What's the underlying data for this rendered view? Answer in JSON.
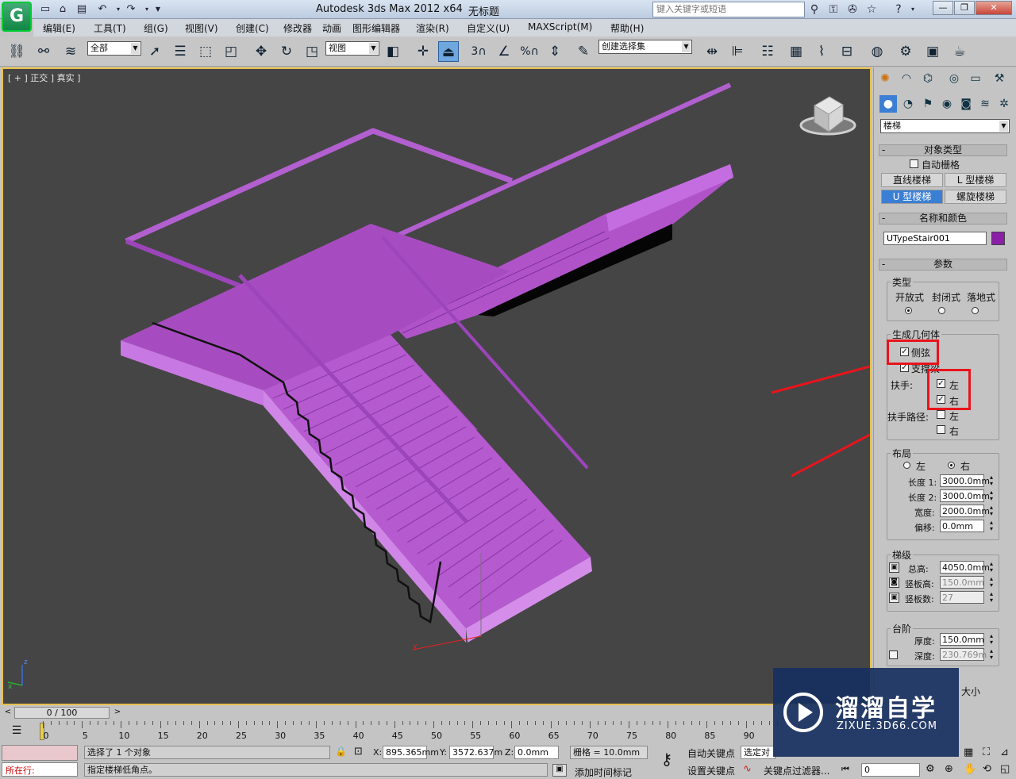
{
  "app": {
    "title": "Autodesk 3ds Max  2012 x64",
    "doc": "无标题",
    "logo": "G",
    "search_placeholder": "键入关键字或短语"
  },
  "menu": [
    "编辑(E)",
    "工具(T)",
    "组(G)",
    "视图(V)",
    "创建(C)",
    "修改器",
    "动画",
    "图形编辑器",
    "渲染(R)",
    "自定义(U)",
    "MAXScript(M)",
    "帮助(H)"
  ],
  "toolbar": {
    "filter": "全部",
    "ref_coord": "视图",
    "selection_set": "创建选择集",
    "snap_3": "3",
    "snap_pct": "%"
  },
  "viewport": {
    "label": "[ + ] 正交 ] 真实 ]",
    "axis_x": "x",
    "axis_y": "y",
    "axis_z": "z",
    "object_color": "#a84fc4"
  },
  "panel": {
    "category": "楼梯",
    "object_type": {
      "title": "对象类型",
      "auto_grid": "自动栅格",
      "buttons": [
        "直线楼梯",
        "L 型楼梯",
        "U 型楼梯",
        "螺旋楼梯"
      ],
      "active": "U 型楼梯"
    },
    "name_color": {
      "title": "名称和颜色",
      "name": "UTypeStair001",
      "color": "#8a1fa8"
    },
    "params": {
      "title": "参数",
      "type": {
        "title": "类型",
        "options": [
          "开放式",
          "封闭式",
          "落地式"
        ]
      },
      "geometry": {
        "title": "生成几何体",
        "stringers": "侧弦",
        "carriage": "支撑梁",
        "handrail": "扶手:",
        "left": "左",
        "right": "右",
        "rail_path": "扶手路径:"
      },
      "layout": {
        "title": "布局",
        "left": "左",
        "right": "右",
        "length1_label": "长度 1:",
        "length1": "3000.0mm",
        "length2_label": "长度 2:",
        "length2": "3000.0mm",
        "width_label": "宽度:",
        "width": "2000.0mm",
        "offset_label": "偏移:",
        "offset": "0.0mm"
      },
      "rise": {
        "title": "梯级",
        "overall_label": "总高:",
        "overall": "4050.0mm",
        "riser_h_label": "竖板高:",
        "riser_h": "150.0mm",
        "riser_c_label": "竖板数:",
        "riser_c": "27"
      },
      "steps": {
        "title": "台阶",
        "thickness_label": "厚度:",
        "thickness": "150.0mm",
        "depth_label": "深度:",
        "depth": "230.769m"
      },
      "size_label": "大小"
    }
  },
  "timeline": {
    "slider": "0 / 100",
    "ticks": [
      "0",
      "5",
      "10",
      "15",
      "20",
      "25",
      "30",
      "35",
      "40",
      "45",
      "50",
      "55",
      "60",
      "65",
      "70",
      "75",
      "80",
      "85",
      "90"
    ]
  },
  "status": {
    "selected": "选择了 1 个对象",
    "prompt": "指定楼梯低角点。",
    "mxs": "所在行:",
    "x_label": "X:",
    "x": "895.365mm",
    "y_label": "Y:",
    "y": "3572.637m",
    "z_label": "Z:",
    "z": "0.0mm",
    "grid": "栅格 = 10.0mm",
    "autokey": "自动关键点",
    "setkey": "设置关键点",
    "sel_target": "选定对",
    "key_filter": "关键点过滤器...",
    "add_tag": "添加时间标记",
    "frame": "0"
  },
  "watermark": {
    "brand": "溜溜自学",
    "url": "ZIXUE.3D66.COM"
  }
}
